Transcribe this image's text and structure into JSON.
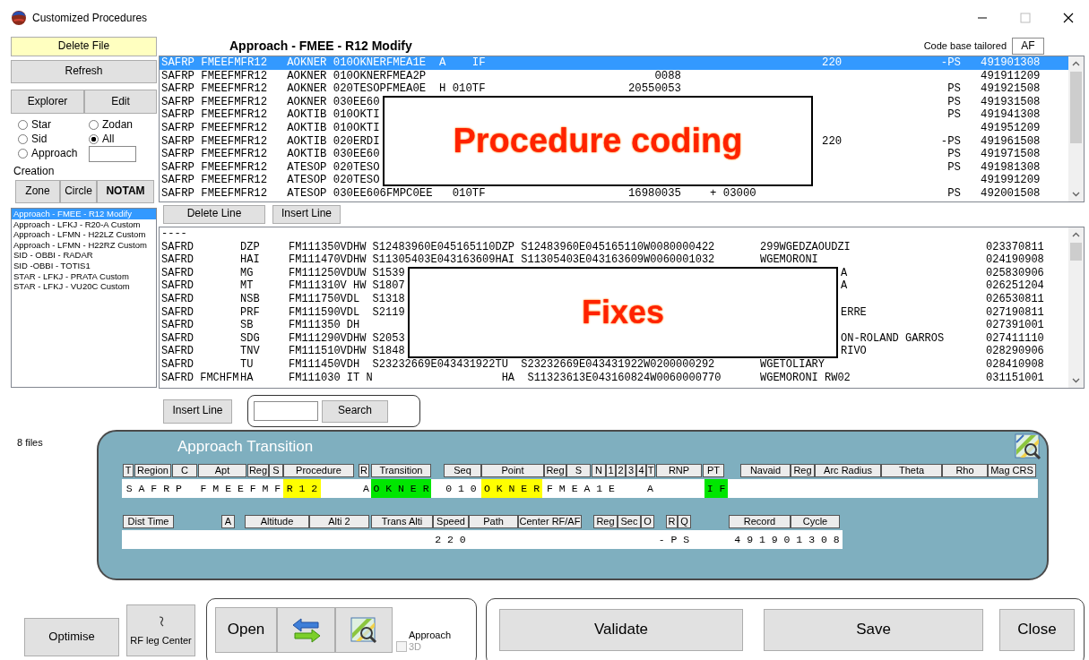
{
  "window": {
    "title": "Customized Procedures"
  },
  "sidebar": {
    "delete_file": "Delete File",
    "refresh": "Refresh",
    "explorer": "Explorer",
    "edit": "Edit",
    "filters": [
      {
        "label": "Star",
        "selected": false
      },
      {
        "label": "Zodan",
        "selected": false
      },
      {
        "label": "Sid",
        "selected": false
      },
      {
        "label": "All",
        "selected": true
      },
      {
        "label": "Approach",
        "selected": false
      }
    ],
    "creation_label": "Creation",
    "creation_buttons": [
      {
        "label": "Zone",
        "bold": false
      },
      {
        "label": "Circle",
        "bold": false
      },
      {
        "label": "NOTAM",
        "bold": true
      }
    ],
    "files": [
      {
        "label": "Approach - FMEE - R12 Modify",
        "selected": true
      },
      {
        "label": "Approach - LFKJ - R20-A Custom",
        "selected": false
      },
      {
        "label": "Approach - LFMN - H22LZ Custom",
        "selected": false
      },
      {
        "label": "Approach - LFMN - H22RZ Custom",
        "selected": false
      },
      {
        "label": "SID - OBBI - RADAR",
        "selected": false
      },
      {
        "label": "SID -OBBI - TOTIS1",
        "selected": false
      },
      {
        "label": "STAR - LFKJ - PRATA Custom",
        "selected": false
      },
      {
        "label": "STAR - LFKJ - VU20C Custom",
        "selected": false
      }
    ],
    "files_count": "8 files"
  },
  "procedure": {
    "title": "Approach - FMEE - R12 Modify",
    "code_base_label": "Code base tailored",
    "code_base_value": "AF",
    "rows": [
      {
        "code": "SAFRP FMEEFMFR12   AOKNER 010OKNERFMEA1E  A    IF",
        "speed": "220",
        "flag": "-PS",
        "record": "491901308",
        "selected": true
      },
      {
        "code": "SAFRP FMEEFMFR12   AOKNER 010OKNERFMEA2P",
        "mid": "0088",
        "record": "491911209",
        "selected": false
      },
      {
        "code": "SAFRP FMEEFMFR12   AOKNER 020TESOPFMEA0E  H 010TF",
        "mid": "20550053",
        "flag": "PS",
        "record": "491921508",
        "selected": false
      },
      {
        "code": "SAFRP FMEEFMFR12   AOKNER 030EE60",
        "flag": "PS",
        "record": "491931508",
        "selected": false
      },
      {
        "code": "SAFRP FMEEFMFR12   AOKTIB 010OKTI",
        "flag": "PS",
        "record": "491941308",
        "selected": false
      },
      {
        "code": "SAFRP FMEEFMFR12   AOKTIB 010OKTI",
        "record": "491951209",
        "selected": false
      },
      {
        "code": "SAFRP FMEEFMFR12   AOKTIB 020ERDI",
        "speed": "220",
        "flag": "-PS",
        "record": "491961508",
        "selected": false
      },
      {
        "code": "SAFRP FMEEFMFR12   AOKTIB 030EE60",
        "flag": "PS",
        "record": "491971508",
        "selected": false
      },
      {
        "code": "SAFRP FMEEFMFR12   ATESOP 020TESO",
        "flag": "PS",
        "record": "491981308",
        "selected": false
      },
      {
        "code": "SAFRP FMEEFMFR12   ATESOP 020TESO",
        "record": "491991209",
        "selected": false
      },
      {
        "code": "SAFRP FMEEFMFR12   ATESOP 030EE606FMPC0EE   010TF",
        "mid": "16980035",
        "offset": "+ 03000",
        "flag": "PS",
        "record": "492001508",
        "selected": false
      }
    ],
    "overlay_label": "Procedure coding",
    "delete_line": "Delete Line",
    "insert_line": "Insert Line"
  },
  "fixes": {
    "rows": [
      {
        "area": "----"
      },
      {
        "area": "SAFRD",
        "ident": "DZP",
        "data": "FM111350VDHW S12483960E045165110DZP S12483960E045165110W0080000422",
        "name": "299WGEDZAOUDZI",
        "record": "023370811"
      },
      {
        "area": "SAFRD",
        "ident": "HAI",
        "data": "FM111470VDHW S11305403E043163609HAI S11305403E043163609W0060001032",
        "name": "WGEMORONI",
        "record": "024190908"
      },
      {
        "area": "SAFRD",
        "ident": "MG",
        "data": "FM111250VDUW S1539",
        "tail": "A",
        "record": "025830906"
      },
      {
        "area": "SAFRD",
        "ident": "MT",
        "data": "FM111310V HW S1807",
        "tail": "A",
        "record": "026251204"
      },
      {
        "area": "SAFRD",
        "ident": "NSB",
        "data": "FM111750VDL  S1318",
        "record": "026530811"
      },
      {
        "area": "SAFRD",
        "ident": "PRF",
        "data": "FM111590VDL  S2119",
        "tail": "ERRE",
        "record": "027190811"
      },
      {
        "area": "SAFRD",
        "ident": "SB",
        "data": "FM111350 DH",
        "record": "027391001"
      },
      {
        "area": "SAFRD",
        "ident": "SDG",
        "data": "FM111290VDHW S2053",
        "tail": "ON-ROLAND GARROS",
        "record": "027411110"
      },
      {
        "area": "SAFRD",
        "ident": "TNV",
        "data": "FM111510VDHW S1848",
        "tail": "RIVO",
        "record": "028290906"
      },
      {
        "area": "SAFRD",
        "ident": "TU",
        "data": "FM111450VDH  S23232669E043431922TU  S23232669E043431922W0200000292",
        "name": "WGETOLIARY",
        "record": "028410908"
      },
      {
        "area": "SAFRD FMCHFM",
        "ident": "HA",
        "data": "FM111030 IT N                    HA  S11323613E043160824W0060000770",
        "name": "WGEMORONI RW02",
        "record": "031151001"
      }
    ],
    "overlay_label": "Fixes",
    "insert_line": "Insert Line",
    "search_button": "Search"
  },
  "transition": {
    "title": "Approach Transition",
    "rows": [
      {
        "headers": [
          "T",
          "Region",
          "C",
          "Apt",
          "Reg",
          "S",
          "Procedure",
          "R",
          "Transition",
          "Seq",
          "Point",
          "Reg",
          "S",
          "N",
          "1",
          "2",
          "3",
          "4",
          "T",
          "RNP",
          "PT",
          "Navaid",
          "Reg",
          "Arc Radius",
          "Theta",
          "Rho",
          "Mag CRS"
        ],
        "values": [
          {
            "text": "S A F R P   F M E E F M F"
          },
          {
            "text": "R 1 2",
            "color": "#ffff00"
          },
          {
            "text": "A"
          },
          {
            "text": "O K N E R",
            "color": "#00e600"
          },
          {
            "text": "0 1 0"
          },
          {
            "text": "O K N E R",
            "color": "#ffff00"
          },
          {
            "text": "F M E A 1 E"
          },
          {
            "text": "A"
          },
          {
            "text": "I F",
            "color": "#00e600"
          }
        ]
      },
      {
        "headers": [
          "Dist Time",
          "A",
          "Altitude",
          "Alti 2",
          "Trans Alti",
          "Speed",
          "Path",
          "Center RF/AF",
          "Reg",
          "Sec",
          "O",
          "R",
          "Q",
          "Record",
          "Cycle"
        ],
        "values": [
          {
            "text": "2 2 0"
          },
          {
            "text": "- P S"
          },
          {
            "text": "4 9 1 9 0 1 3 0 8"
          }
        ]
      }
    ]
  },
  "bottom": {
    "optimise": "Optimise",
    "rf_leg_center": "RF leg Center",
    "open": "Open",
    "approach_label": "Approach",
    "three_d": {
      "label": "3D",
      "checked": false,
      "disabled": true
    },
    "validate": "Validate",
    "save": "Save",
    "close": "Close"
  }
}
